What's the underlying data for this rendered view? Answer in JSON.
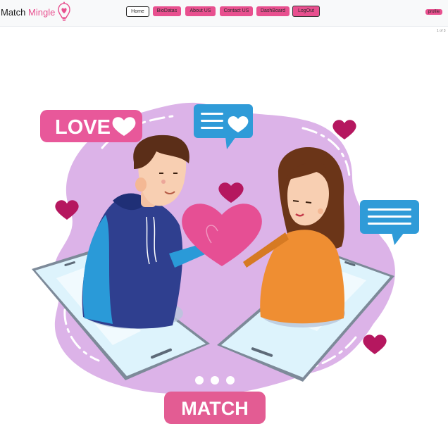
{
  "brand": {
    "name_part1": "Match",
    "name_part2": "Mingle",
    "logo_icon": "heart-bulb-icon"
  },
  "nav": {
    "items": [
      {
        "label": "Home",
        "active": true
      },
      {
        "label": "BioDatas"
      },
      {
        "label": "About US"
      },
      {
        "label": "Contact US"
      },
      {
        "label": "DashBoard"
      },
      {
        "label": "LogOut"
      }
    ],
    "profile_label": "profile"
  },
  "carousel": {
    "indicator": "1 of 3"
  },
  "hero": {
    "love_label": "LOVE",
    "match_label": "MATCH",
    "icons": [
      "heart-icon",
      "chat-bubble-icon",
      "smartphone-icon"
    ]
  },
  "colors": {
    "accent": "#e8508f",
    "blob": "#dcb3e8",
    "love_label_bg": "#e8589a",
    "match_label_bg": "#e35c93",
    "heart_dark": "#b5175f",
    "chat_blue": "#2f9bd8"
  }
}
